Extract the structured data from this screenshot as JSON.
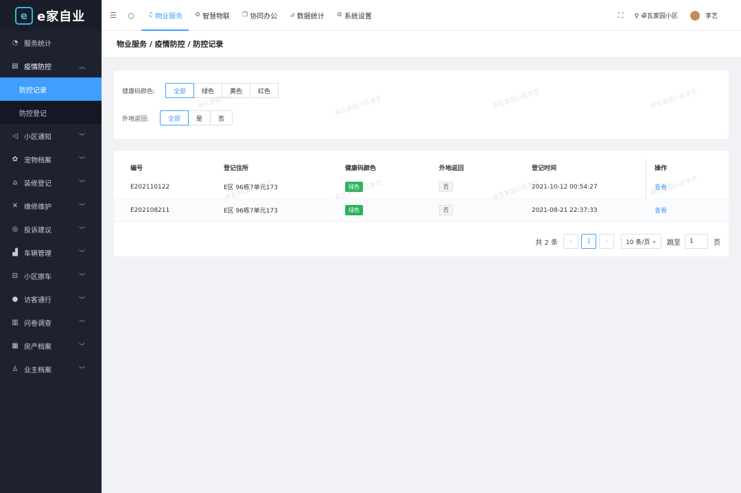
{
  "brand": {
    "logo_letter": "e",
    "name": "e家自业"
  },
  "sidebar": {
    "items": [
      {
        "label": "服务统计",
        "icon": "dashboard-icon",
        "glyph": "◔"
      },
      {
        "label": "疫情防控",
        "icon": "epidemic-icon",
        "glyph": "▤",
        "expanded": true
      },
      {
        "label": "小区通知",
        "icon": "megaphone-icon",
        "glyph": "◁"
      },
      {
        "label": "宠物档案",
        "icon": "pet-icon",
        "glyph": "✿"
      },
      {
        "label": "装修登记",
        "icon": "home-icon",
        "glyph": "⌂"
      },
      {
        "label": "维修维护",
        "icon": "tools-icon",
        "glyph": "✕"
      },
      {
        "label": "投诉建议",
        "icon": "complaint-icon",
        "glyph": "◎"
      },
      {
        "label": "车辆管理",
        "icon": "vehicle-icon",
        "glyph": "▟"
      },
      {
        "label": "小区挪车",
        "icon": "car-icon",
        "glyph": "⊟"
      },
      {
        "label": "访客通行",
        "icon": "visitor-icon",
        "glyph": "●"
      },
      {
        "label": "问卷调查",
        "icon": "survey-icon",
        "glyph": "▥"
      },
      {
        "label": "房产档案",
        "icon": "building-icon",
        "glyph": "▦"
      },
      {
        "label": "业主档案",
        "icon": "owner-icon",
        "glyph": "♙"
      }
    ],
    "sub_items": [
      {
        "label": "防控记录",
        "active": true
      },
      {
        "label": "防控登记",
        "active": false
      }
    ]
  },
  "topbar": {
    "tabs": [
      {
        "label": "物业服务",
        "active": true
      },
      {
        "label": "智慧物联",
        "active": false
      },
      {
        "label": "协同办公",
        "active": false
      },
      {
        "label": "数据统计",
        "active": false
      },
      {
        "label": "系统设置",
        "active": false
      }
    ],
    "community": "卓瓦家园小区",
    "user": "李艺"
  },
  "breadcrumb": "物业服务 / 疫情防控 / 防控记录",
  "filters": {
    "health_label": "健康码颜色:",
    "health_options": [
      "全部",
      "绿色",
      "黄色",
      "红色"
    ],
    "health_selected": "全部",
    "return_label": "外地返回:",
    "return_options": [
      "全部",
      "是",
      "否"
    ],
    "return_selected": "全部"
  },
  "table": {
    "headers": [
      "编号",
      "登记住所",
      "健康码颜色",
      "外地返回",
      "登记时间",
      "操作"
    ],
    "rows": [
      {
        "id": "E202110122",
        "address": "E区 96栋7单元173",
        "health": "绿色",
        "returned": "否",
        "time": "2021-10-12 00:54:27",
        "action": "查看"
      },
      {
        "id": "E202108211",
        "address": "E区 96栋7单元173",
        "health": "绿色",
        "returned": "否",
        "time": "2021-08-21 22:37:33",
        "action": "查看"
      }
    ]
  },
  "pagination": {
    "total_text": "共 2 条",
    "current_page": "1",
    "page_size": "10 条/页",
    "jump_label": "跳至",
    "jump_value": "1",
    "page_suffix": "页"
  },
  "watermark": "卓瓦家园小区李艺",
  "colors": {
    "accent": "#409eff",
    "sidebar_bg": "#1e2130",
    "green_tag": "#27b45a"
  }
}
